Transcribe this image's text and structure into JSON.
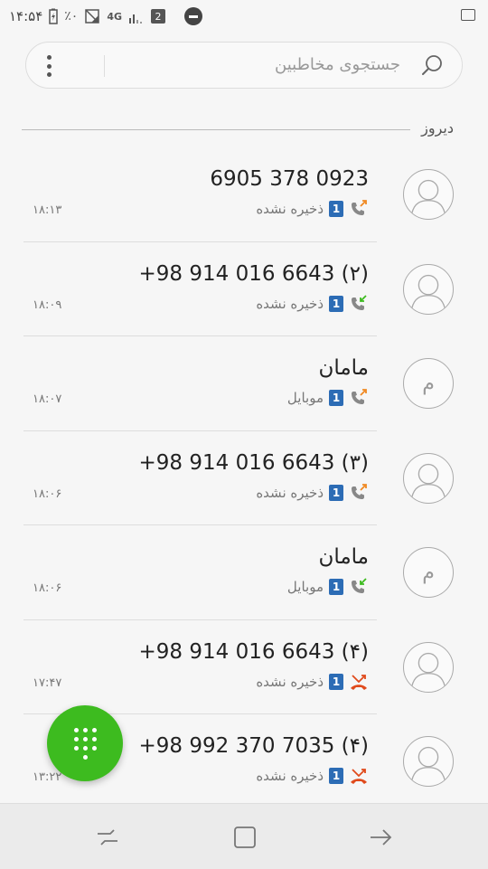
{
  "status_bar": {
    "time": "۱۴:۵۴",
    "battery_percent": "٪۰",
    "network": "4G",
    "sim_indicator": "2"
  },
  "search": {
    "placeholder": "جستجوی مخاطبین"
  },
  "section": {
    "title": "دیروز"
  },
  "calls": [
    {
      "name": "0923 378 6905",
      "label": "ذخیره نشده",
      "sim": "1",
      "call_type": "outgoing",
      "time": "۱۸:۱۳",
      "avatar": "person",
      "avatar_letter": ""
    },
    {
      "name": "(۲) 6643 016 914 98+",
      "label": "ذخیره نشده",
      "sim": "1",
      "call_type": "incoming",
      "time": "۱۸:۰۹",
      "avatar": "person",
      "avatar_letter": ""
    },
    {
      "name": "مامان",
      "label": "موبایل",
      "sim": "1",
      "call_type": "outgoing",
      "time": "۱۸:۰۷",
      "avatar": "letter",
      "avatar_letter": "م"
    },
    {
      "name": "(۳) 6643 016 914 98+",
      "label": "ذخیره نشده",
      "sim": "1",
      "call_type": "outgoing",
      "time": "۱۸:۰۶",
      "avatar": "person",
      "avatar_letter": ""
    },
    {
      "name": "مامان",
      "label": "موبایل",
      "sim": "1",
      "call_type": "incoming",
      "time": "۱۸:۰۶",
      "avatar": "letter",
      "avatar_letter": "م"
    },
    {
      "name": "(۴) 6643 016 914 98+",
      "label": "ذخیره نشده",
      "sim": "1",
      "call_type": "missed",
      "time": "۱۷:۴۷",
      "avatar": "person",
      "avatar_letter": ""
    },
    {
      "name": "(۴) 7035 370 992 98+",
      "label": "ذخیره نشده",
      "sim": "1",
      "call_type": "missed",
      "time": "۱۳:۲۲",
      "avatar": "person",
      "avatar_letter": ""
    }
  ],
  "colors": {
    "fab": "#3dbb1f",
    "sim_badge": "#2c6cb5",
    "outgoing_arrow": "#f08a24",
    "incoming_arrow": "#3dbb1f",
    "missed": "#e04a1c"
  }
}
